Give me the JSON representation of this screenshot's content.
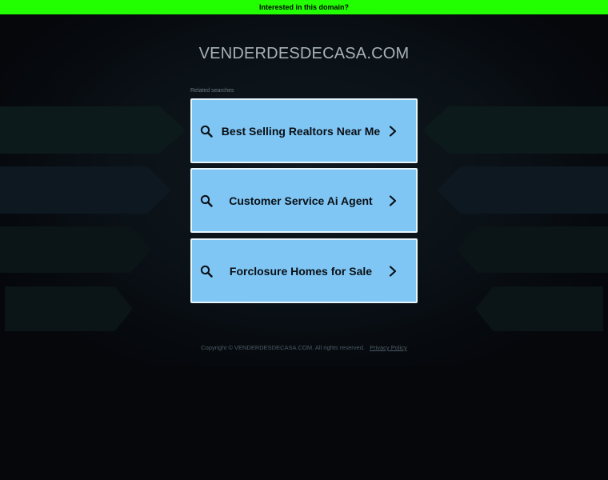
{
  "banner": {
    "text": "Interested in this domain?"
  },
  "domain": {
    "title": "VENDERDESDECASA.COM"
  },
  "related": {
    "label": "Related searches",
    "items": [
      {
        "label": "Best Selling Realtors Near Me",
        "icon": "search-icon",
        "arrow": "chevron-right-icon"
      },
      {
        "label": "Customer Service Ai Agent",
        "icon": "search-icon",
        "arrow": "chevron-right-icon"
      },
      {
        "label": "Forclosure Homes for Sale",
        "icon": "search-icon",
        "arrow": "chevron-right-icon"
      }
    ]
  },
  "footer": {
    "copyright": "Copyright © VENDERDESDECASA.COM.  All rights reserved.",
    "privacy": "Privacy Policy"
  },
  "colors": {
    "banner": "#22ff00",
    "background": "#05070b",
    "card": "#7fc6f5",
    "card_border": "#e6f4fc"
  }
}
